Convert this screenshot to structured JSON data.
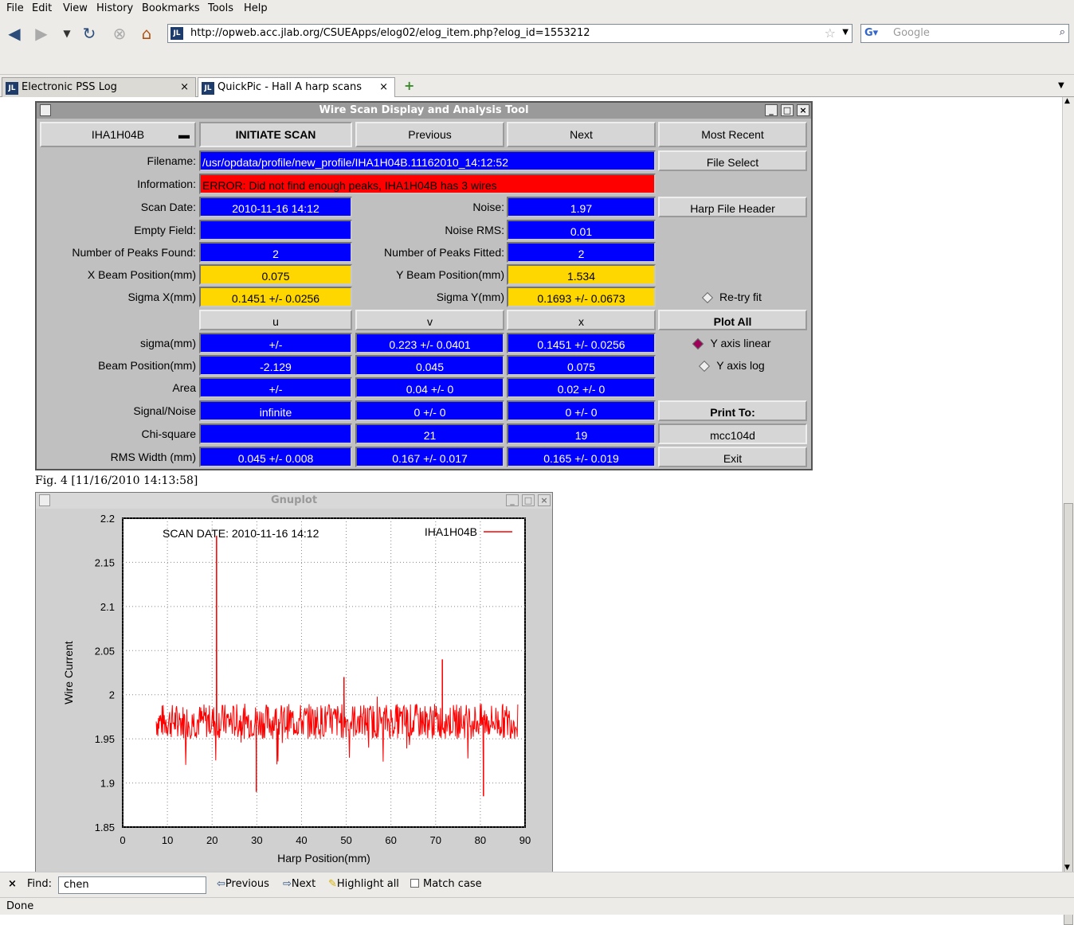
{
  "menu": [
    "File",
    "Edit",
    "View",
    "History",
    "Bookmarks",
    "Tools",
    "Help"
  ],
  "url": "http://opweb.acc.jlab.org/CSUEApps/elog02/elog_item.php?elog_id=1553212",
  "search_placeholder": "Google",
  "tabs": [
    {
      "label": "Electronic PSS Log"
    },
    {
      "label": "QuickPic - Hall A harp scans"
    }
  ],
  "wintitle": "Wire Scan Display and Analysis Tool",
  "top": {
    "harp": "IHA1H04B",
    "initiate": "INITIATE SCAN",
    "previous": "Previous",
    "next": "Next",
    "most_recent": "Most Recent"
  },
  "filename_label": "Filename:",
  "filename": "/usr/opdata/profile/new_profile/IHA1H04B.11162010_14:12:52",
  "file_select": "File Select",
  "info_label": "Information:",
  "info": "ERROR: Did not find enough peaks, IHA1H04B has 3 wires",
  "scan_date_label": "Scan Date:",
  "scan_date": "2010-11-16   14:12",
  "noise_label": "Noise:",
  "noise": "1.97",
  "harp_header": "Harp File Header",
  "empty_label": "Empty Field:",
  "noise_rms_label": "Noise RMS:",
  "noise_rms": "0.01",
  "peaks_found_label": "Number of Peaks Found:",
  "peaks_found": "2",
  "peaks_fitted_label": "Number of Peaks Fitted:",
  "peaks_fitted": "2",
  "xbeam_label": "X Beam Position(mm)",
  "xbeam": "0.075",
  "ybeam_label": "Y Beam Position(mm)",
  "ybeam": "1.534",
  "sigx_label": "Sigma X(mm)",
  "sigx": "0.1451 +/- 0.0256",
  "sigy_label": "Sigma Y(mm)",
  "sigy": "0.1693 +/- 0.0673",
  "retry": "Re-try fit",
  "cols": [
    "u",
    "v",
    "x"
  ],
  "plot_all": "Plot All",
  "rows": [
    {
      "label": "sigma(mm)",
      "u": "+/-",
      "v": "0.223 +/- 0.0401",
      "x": "0.1451 +/- 0.0256"
    },
    {
      "label": "Beam Position(mm)",
      "u": "-2.129",
      "v": "0.045",
      "x": "0.075"
    },
    {
      "label": "Area",
      "u": "+/-",
      "v": "0.04 +/- 0",
      "x": "0.02 +/- 0"
    },
    {
      "label": "Signal/Noise",
      "u": "infinite",
      "v": "0 +/- 0",
      "x": "0 +/- 0"
    },
    {
      "label": "Chi-square",
      "u": "",
      "v": "21",
      "x": "19"
    },
    {
      "label": "RMS Width (mm)",
      "u": "0.045 +/- 0.008",
      "v": "0.167 +/- 0.017",
      "x": "0.165 +/- 0.019"
    }
  ],
  "ylinear": "Y axis linear",
  "ylog": "Y axis log",
  "print_to": "Print To:",
  "printer": "mcc104d",
  "exit": "Exit",
  "fig_caption": "Fig. 4 [11/16/2010 14:13:58]",
  "gnuplot_title": "Gnuplot",
  "chart_data": {
    "type": "line",
    "title": "SCAN DATE: 2010-11-16   14:12",
    "xlabel": "Harp Position(mm)",
    "ylabel": "Wire Current",
    "xlim": [
      0,
      90
    ],
    "ylim": [
      1.85,
      2.2
    ],
    "xticks": [
      0,
      10,
      20,
      30,
      40,
      50,
      60,
      70,
      80,
      90
    ],
    "yticks": [
      1.85,
      1.9,
      1.95,
      2,
      2.05,
      2.1,
      2.15,
      2.2
    ],
    "series": [
      {
        "name": "IHA1H04B",
        "color": "#ff0000",
        "baseline": 1.97,
        "x": [
          7.5,
          20.5,
          21,
          21.5,
          29.9,
          49.5,
          50,
          71.5,
          72,
          80.7,
          88.5
        ],
        "y": [
          1.97,
          1.97,
          2.18,
          1.97,
          1.89,
          2.02,
          1.97,
          2.04,
          1.97,
          1.885,
          1.97
        ]
      }
    ],
    "grid": true,
    "legend": "top-right"
  },
  "find": {
    "label": "Find:",
    "value": "chen",
    "previous": "Previous",
    "next": "Next",
    "highlight": "Highlight all",
    "match": "Match case"
  },
  "status": "Done"
}
